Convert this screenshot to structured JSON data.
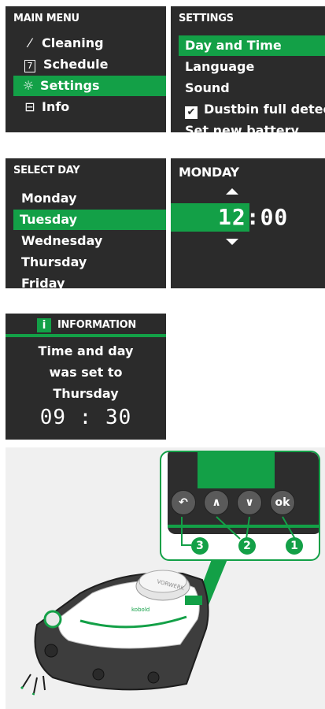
{
  "main_menu": {
    "title": "MAIN MENU",
    "items": [
      {
        "label": "Cleaning",
        "icon": "broom-icon",
        "glyph": "⁄"
      },
      {
        "label": "Schedule",
        "icon": "calendar-icon",
        "glyph": "7"
      },
      {
        "label": "Settings",
        "icon": "gear-icon",
        "glyph": "☼",
        "selected": true
      },
      {
        "label": "Info",
        "icon": "info-card-icon",
        "glyph": "⊟"
      }
    ]
  },
  "settings_menu": {
    "title": "SETTINGS",
    "items": [
      {
        "label": "Day and Time",
        "selected": true
      },
      {
        "label": "Language"
      },
      {
        "label": "Sound"
      },
      {
        "label": "Dustbin full detect",
        "checked": true
      },
      {
        "label": "Set new battery"
      }
    ]
  },
  "select_day": {
    "title": "SELECT DAY",
    "items": [
      {
        "label": "Monday"
      },
      {
        "label": "Tuesday",
        "selected": true
      },
      {
        "label": "Wednesday"
      },
      {
        "label": "Thursday"
      },
      {
        "label": "Friday"
      }
    ]
  },
  "time_set": {
    "title": "MONDAY",
    "hours": "12",
    "separator": ":",
    "minutes": "00"
  },
  "information": {
    "icon_letter": "i",
    "title": "INFORMATION",
    "lines": [
      "Time and day",
      "was set to",
      "Thursday"
    ],
    "time": "09 : 30"
  },
  "device": {
    "buttons": [
      {
        "label": "↶",
        "icon": "back-arrow-icon"
      },
      {
        "label": "∧",
        "icon": "up-chevron-icon"
      },
      {
        "label": "∨",
        "icon": "down-chevron-icon"
      },
      {
        "label": "ok",
        "icon": "ok-button"
      }
    ],
    "callouts": [
      "3",
      "2",
      "1"
    ],
    "brand_text": "kobold",
    "logo_text": "VORWERK"
  },
  "colors": {
    "accent": "#13a047",
    "screen_bg": "#2b2b2b",
    "text": "#ffffff"
  }
}
